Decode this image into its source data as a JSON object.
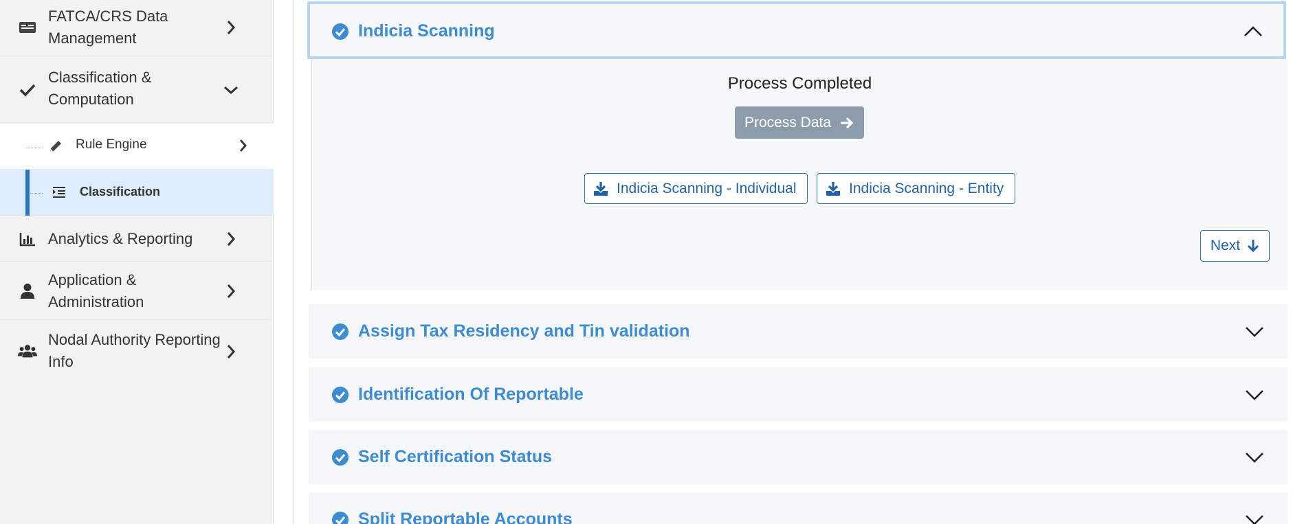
{
  "sidebar": {
    "items": [
      {
        "label": "FATCA/CRS Data Management",
        "icon": "id-card-icon"
      },
      {
        "label": "Classification & Computation",
        "icon": "check-icon",
        "expanded": true
      },
      {
        "label": "Analytics & Reporting",
        "icon": "bar-chart-icon"
      },
      {
        "label": "Application & Administration",
        "icon": "user-icon"
      },
      {
        "label": "Nodal Authority Reporting Info",
        "icon": "users-icon"
      }
    ],
    "subitems": [
      {
        "label": "Rule Engine",
        "icon": "pencil-icon"
      },
      {
        "label": "Classification",
        "icon": "list-indent-icon",
        "active": true
      }
    ]
  },
  "accordion": {
    "open_section": {
      "title": "Indicia Scanning",
      "status": "Process Completed",
      "process_button": "Process Data",
      "download_individual": "Indicia Scanning - Individual",
      "download_entity": "Indicia Scanning - Entity",
      "next_button": "Next"
    },
    "collapsed_sections": [
      {
        "title": "Assign Tax Residency and Tin validation"
      },
      {
        "title": "Identification Of Reportable"
      },
      {
        "title": "Self Certification Status"
      },
      {
        "title": "Split Reportable Accounts"
      }
    ]
  },
  "colors": {
    "accent": "#3d8bd0",
    "active_bg": "#deedfb",
    "active_bar": "#2e74c0",
    "button_disabled": "#8d9cab",
    "button_outline": "#2e6fb5"
  }
}
